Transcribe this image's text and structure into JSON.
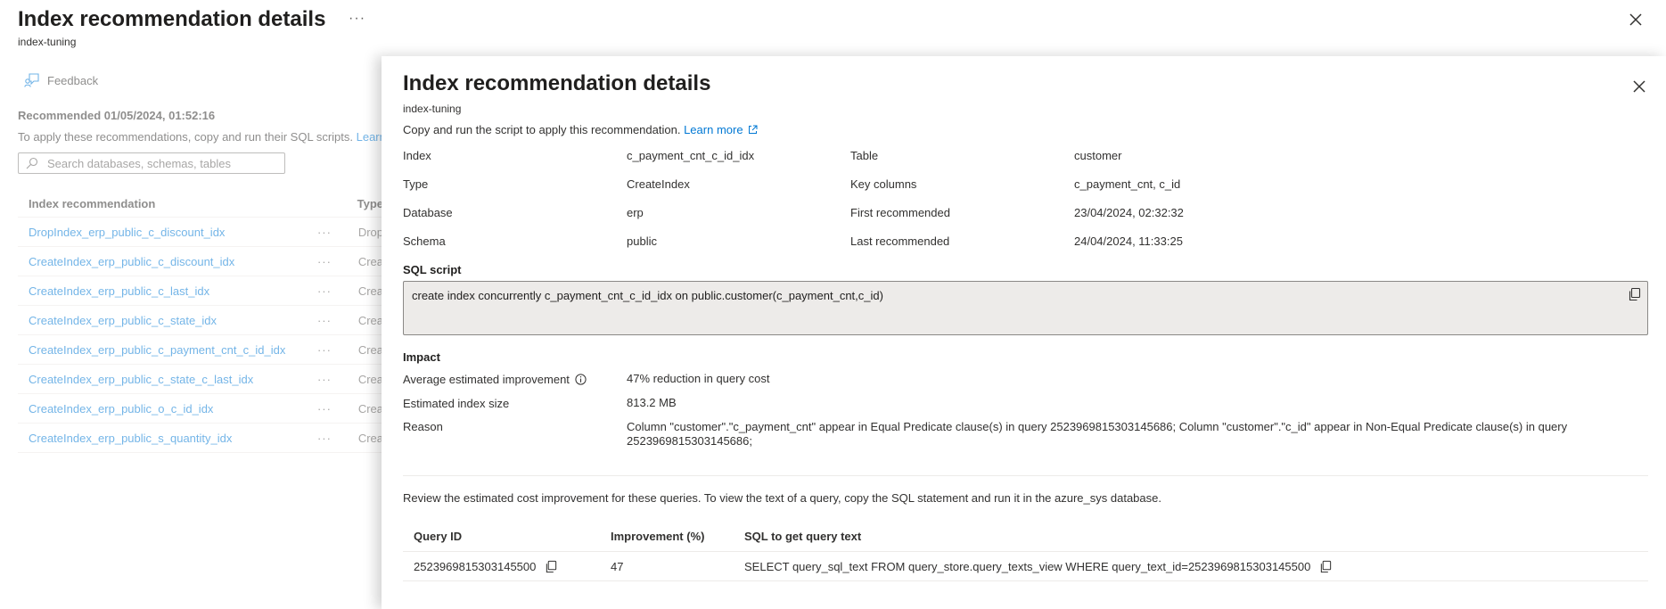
{
  "background": {
    "title": "Index recommendation details",
    "ellipsis": "···",
    "subtitle": "index-tuning",
    "feedback_label": "Feedback",
    "recommended_label": "Recommended 01/05/2024, 01:52:16",
    "hint_text": "To apply these recommendations, copy and run their SQL scripts.",
    "hint_link": "Learn",
    "search_placeholder": "Search databases, schemas, tables",
    "table": {
      "headers": [
        "Index recommendation",
        "Type"
      ],
      "rows": [
        {
          "name": "DropIndex_erp_public_c_discount_idx",
          "dots": "···",
          "type": "Drop"
        },
        {
          "name": "CreateIndex_erp_public_c_discount_idx",
          "dots": "···",
          "type": "Crea"
        },
        {
          "name": "CreateIndex_erp_public_c_last_idx",
          "dots": "···",
          "type": "Crea"
        },
        {
          "name": "CreateIndex_erp_public_c_state_idx",
          "dots": "···",
          "type": "Crea"
        },
        {
          "name": "CreateIndex_erp_public_c_payment_cnt_c_id_idx",
          "dots": "···",
          "type": "Crea"
        },
        {
          "name": "CreateIndex_erp_public_c_state_c_last_idx",
          "dots": "···",
          "type": "Crea"
        },
        {
          "name": "CreateIndex_erp_public_o_c_id_idx",
          "dots": "···",
          "type": "Crea"
        },
        {
          "name": "CreateIndex_erp_public_s_quantity_idx",
          "dots": "···",
          "type": "Crea"
        }
      ]
    }
  },
  "panel": {
    "title": "Index recommendation details",
    "subtitle": "index-tuning",
    "copy_text": "Copy and run the script to apply this recommendation.",
    "learn_more": "Learn more",
    "details": [
      {
        "k1": "Index",
        "v1": "c_payment_cnt_c_id_idx",
        "k2": "Table",
        "v2": "customer"
      },
      {
        "k1": "Type",
        "v1": "CreateIndex",
        "k2": "Key columns",
        "v2": "c_payment_cnt, c_id"
      },
      {
        "k1": "Database",
        "v1": "erp",
        "k2": "First recommended",
        "v2": "23/04/2024, 02:32:32"
      },
      {
        "k1": "Schema",
        "v1": "public",
        "k2": "Last recommended",
        "v2": "24/04/2024, 11:33:25"
      }
    ],
    "sql_label": "SQL script",
    "sql_script": "create index concurrently c_payment_cnt_c_id_idx on public.customer(c_payment_cnt,c_id)",
    "impact_label": "Impact",
    "impact": {
      "avg_label": "Average estimated improvement",
      "avg_value": "47% reduction in query cost",
      "size_label": "Estimated index size",
      "size_value": "813.2 MB",
      "reason_label": "Reason",
      "reason_value": "Column \"customer\".\"c_payment_cnt\" appear in Equal Predicate clause(s) in query 2523969815303145686; Column \"customer\".\"c_id\" appear in Non-Equal Predicate clause(s) in query 2523969815303145686;"
    },
    "review_text": "Review the estimated cost improvement for these queries. To view the text of a query, copy the SQL statement and run it in the azure_sys database.",
    "queries": {
      "headers": [
        "Query ID",
        "Improvement (%)",
        "SQL to get query text"
      ],
      "rows": [
        {
          "id": "2523969815303145500",
          "improvement": "47",
          "sql": "SELECT query_sql_text FROM query_store.query_texts_view WHERE query_text_id=2523969815303145500"
        }
      ]
    }
  },
  "colors": {
    "link": "#0078d4",
    "text": "#323130",
    "title": "#201f1e",
    "sql_box_bg": "#edebe9"
  }
}
